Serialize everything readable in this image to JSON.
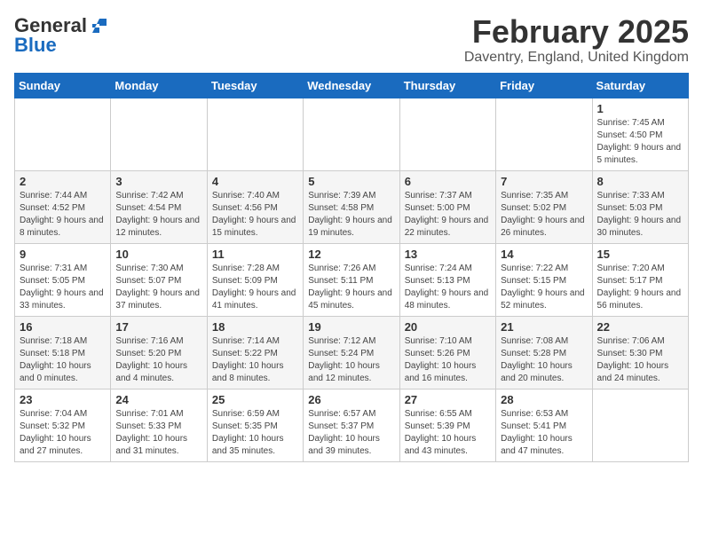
{
  "logo": {
    "general": "General",
    "blue": "Blue"
  },
  "header": {
    "month": "February 2025",
    "location": "Daventry, England, United Kingdom"
  },
  "weekdays": [
    "Sunday",
    "Monday",
    "Tuesday",
    "Wednesday",
    "Thursday",
    "Friday",
    "Saturday"
  ],
  "weeks": [
    [
      {
        "day": "",
        "info": ""
      },
      {
        "day": "",
        "info": ""
      },
      {
        "day": "",
        "info": ""
      },
      {
        "day": "",
        "info": ""
      },
      {
        "day": "",
        "info": ""
      },
      {
        "day": "",
        "info": ""
      },
      {
        "day": "1",
        "info": "Sunrise: 7:45 AM\nSunset: 4:50 PM\nDaylight: 9 hours and 5 minutes."
      }
    ],
    [
      {
        "day": "2",
        "info": "Sunrise: 7:44 AM\nSunset: 4:52 PM\nDaylight: 9 hours and 8 minutes."
      },
      {
        "day": "3",
        "info": "Sunrise: 7:42 AM\nSunset: 4:54 PM\nDaylight: 9 hours and 12 minutes."
      },
      {
        "day": "4",
        "info": "Sunrise: 7:40 AM\nSunset: 4:56 PM\nDaylight: 9 hours and 15 minutes."
      },
      {
        "day": "5",
        "info": "Sunrise: 7:39 AM\nSunset: 4:58 PM\nDaylight: 9 hours and 19 minutes."
      },
      {
        "day": "6",
        "info": "Sunrise: 7:37 AM\nSunset: 5:00 PM\nDaylight: 9 hours and 22 minutes."
      },
      {
        "day": "7",
        "info": "Sunrise: 7:35 AM\nSunset: 5:02 PM\nDaylight: 9 hours and 26 minutes."
      },
      {
        "day": "8",
        "info": "Sunrise: 7:33 AM\nSunset: 5:03 PM\nDaylight: 9 hours and 30 minutes."
      }
    ],
    [
      {
        "day": "9",
        "info": "Sunrise: 7:31 AM\nSunset: 5:05 PM\nDaylight: 9 hours and 33 minutes."
      },
      {
        "day": "10",
        "info": "Sunrise: 7:30 AM\nSunset: 5:07 PM\nDaylight: 9 hours and 37 minutes."
      },
      {
        "day": "11",
        "info": "Sunrise: 7:28 AM\nSunset: 5:09 PM\nDaylight: 9 hours and 41 minutes."
      },
      {
        "day": "12",
        "info": "Sunrise: 7:26 AM\nSunset: 5:11 PM\nDaylight: 9 hours and 45 minutes."
      },
      {
        "day": "13",
        "info": "Sunrise: 7:24 AM\nSunset: 5:13 PM\nDaylight: 9 hours and 48 minutes."
      },
      {
        "day": "14",
        "info": "Sunrise: 7:22 AM\nSunset: 5:15 PM\nDaylight: 9 hours and 52 minutes."
      },
      {
        "day": "15",
        "info": "Sunrise: 7:20 AM\nSunset: 5:17 PM\nDaylight: 9 hours and 56 minutes."
      }
    ],
    [
      {
        "day": "16",
        "info": "Sunrise: 7:18 AM\nSunset: 5:18 PM\nDaylight: 10 hours and 0 minutes."
      },
      {
        "day": "17",
        "info": "Sunrise: 7:16 AM\nSunset: 5:20 PM\nDaylight: 10 hours and 4 minutes."
      },
      {
        "day": "18",
        "info": "Sunrise: 7:14 AM\nSunset: 5:22 PM\nDaylight: 10 hours and 8 minutes."
      },
      {
        "day": "19",
        "info": "Sunrise: 7:12 AM\nSunset: 5:24 PM\nDaylight: 10 hours and 12 minutes."
      },
      {
        "day": "20",
        "info": "Sunrise: 7:10 AM\nSunset: 5:26 PM\nDaylight: 10 hours and 16 minutes."
      },
      {
        "day": "21",
        "info": "Sunrise: 7:08 AM\nSunset: 5:28 PM\nDaylight: 10 hours and 20 minutes."
      },
      {
        "day": "22",
        "info": "Sunrise: 7:06 AM\nSunset: 5:30 PM\nDaylight: 10 hours and 24 minutes."
      }
    ],
    [
      {
        "day": "23",
        "info": "Sunrise: 7:04 AM\nSunset: 5:32 PM\nDaylight: 10 hours and 27 minutes."
      },
      {
        "day": "24",
        "info": "Sunrise: 7:01 AM\nSunset: 5:33 PM\nDaylight: 10 hours and 31 minutes."
      },
      {
        "day": "25",
        "info": "Sunrise: 6:59 AM\nSunset: 5:35 PM\nDaylight: 10 hours and 35 minutes."
      },
      {
        "day": "26",
        "info": "Sunrise: 6:57 AM\nSunset: 5:37 PM\nDaylight: 10 hours and 39 minutes."
      },
      {
        "day": "27",
        "info": "Sunrise: 6:55 AM\nSunset: 5:39 PM\nDaylight: 10 hours and 43 minutes."
      },
      {
        "day": "28",
        "info": "Sunrise: 6:53 AM\nSunset: 5:41 PM\nDaylight: 10 hours and 47 minutes."
      },
      {
        "day": "",
        "info": ""
      }
    ]
  ]
}
